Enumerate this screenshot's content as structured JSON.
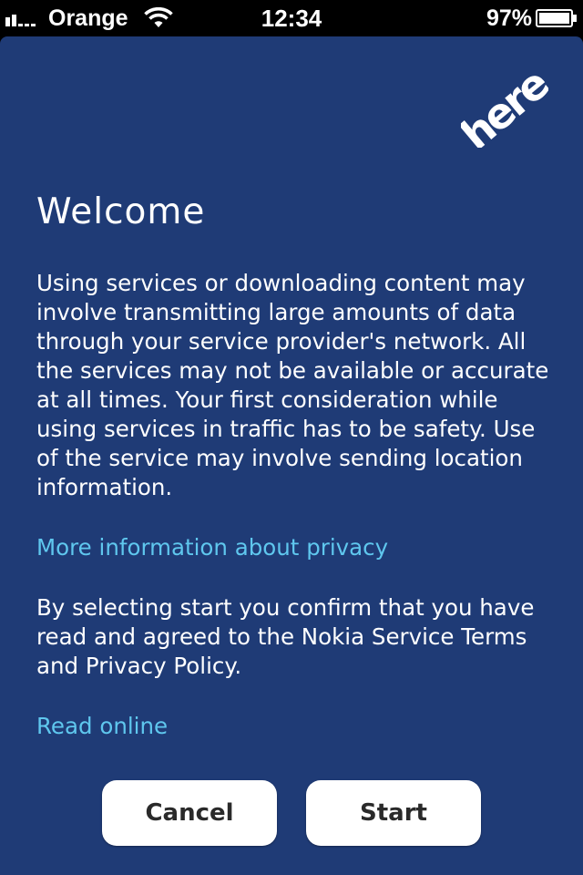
{
  "status_bar": {
    "carrier": "Orange",
    "time": "12:34",
    "battery_percent": "97%",
    "battery_level": 0.97,
    "icons": [
      "signal-icon",
      "wifi-icon",
      "battery-icon"
    ]
  },
  "dialog": {
    "logo_text": "here",
    "title": "Welcome",
    "paragraph_1": "Using services or downloading content may involve transmitting large amounts of data through your service provider's network. All the services may not be available or accurate at all times. Your first consideration while using services in traffic has to be safety. Use of the service may involve sending location information.",
    "privacy_link": "More information about privacy",
    "paragraph_2": "By selecting start you confirm that you have read and agreed to the Nokia Service Terms and Privacy Policy.",
    "read_online_link": "Read online",
    "cancel_label": "Cancel",
    "start_label": "Start"
  },
  "colors": {
    "panel_background": "#1f3b76",
    "link": "#5fc7ee",
    "text": "#ffffff",
    "button": "#ffffff"
  }
}
